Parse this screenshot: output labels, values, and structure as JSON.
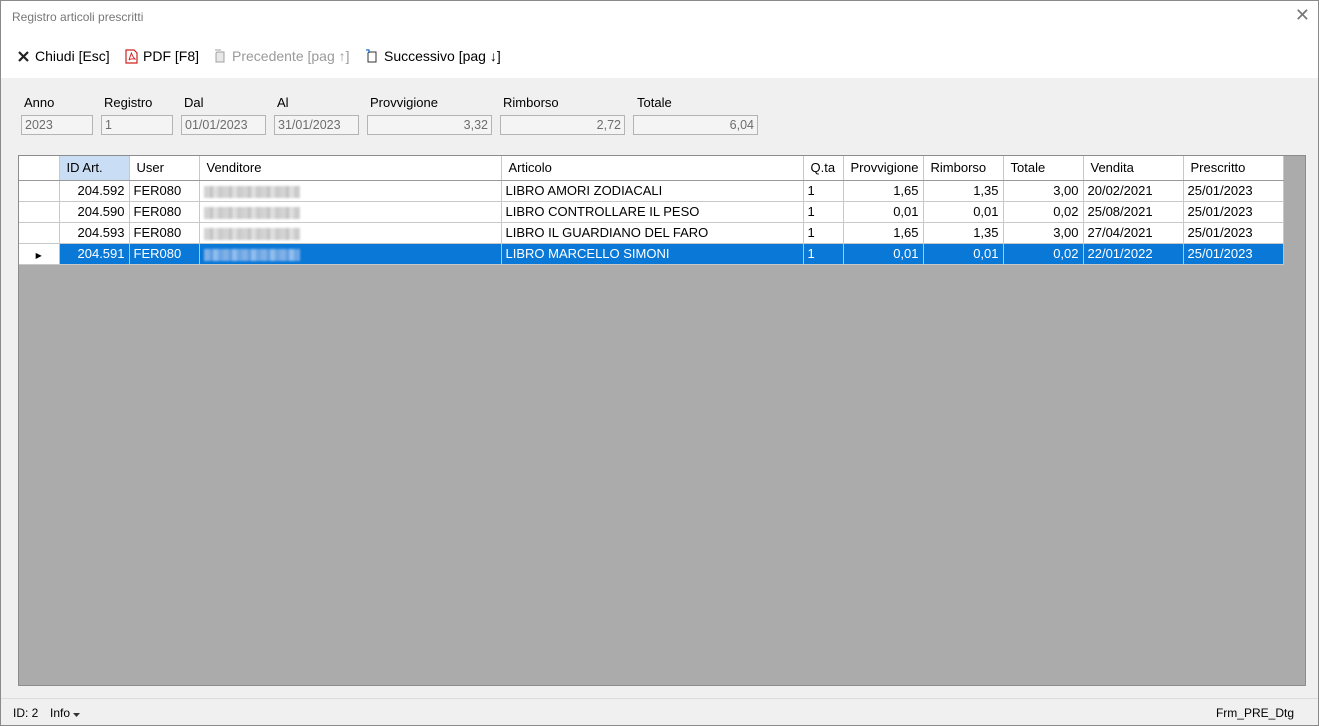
{
  "window": {
    "title": "Registro articoli prescritti",
    "close_glyph": "✕"
  },
  "toolbar": {
    "close_label": "Chiudi [Esc]",
    "pdf_label": "PDF [F8]",
    "prev_label": "Precedente [pag ↑]",
    "next_label": "Successivo [pag ↓]"
  },
  "filters": {
    "anno": {
      "label": "Anno",
      "value": "2023"
    },
    "registro": {
      "label": "Registro",
      "value": "1"
    },
    "dal": {
      "label": "Dal",
      "value": "01/01/2023"
    },
    "al": {
      "label": "Al",
      "value": "31/01/2023"
    },
    "provvigione": {
      "label": "Provvigione",
      "value": "3,32"
    },
    "rimborso": {
      "label": "Rimborso",
      "value": "2,72"
    },
    "totale": {
      "label": "Totale",
      "value": "6,04"
    }
  },
  "grid": {
    "columns": [
      "ID Art.",
      "User",
      "Venditore",
      "Articolo",
      "Q.ta",
      "Provvigione",
      "Rimborso",
      "Totale",
      "Vendita",
      "Prescritto"
    ],
    "sorted_column": "ID Art.",
    "current_row_marker": "▶",
    "rows": [
      {
        "id": "204.592",
        "user": "FER080",
        "articolo": "LIBRO AMORI ZODIACALI",
        "qta": "1",
        "provvigione": "1,65",
        "rimborso": "1,35",
        "totale": "3,00",
        "vendita": "20/02/2021",
        "prescritto": "25/01/2023",
        "selected": false
      },
      {
        "id": "204.590",
        "user": "FER080",
        "articolo": "LIBRO CONTROLLARE IL PESO",
        "qta": "1",
        "provvigione": "0,01",
        "rimborso": "0,01",
        "totale": "0,02",
        "vendita": "25/08/2021",
        "prescritto": "25/01/2023",
        "selected": false
      },
      {
        "id": "204.593",
        "user": "FER080",
        "articolo": "LIBRO IL GUARDIANO DEL FARO",
        "qta": "1",
        "provvigione": "1,65",
        "rimborso": "1,35",
        "totale": "3,00",
        "vendita": "27/04/2021",
        "prescritto": "25/01/2023",
        "selected": false
      },
      {
        "id": "204.591",
        "user": "FER080",
        "articolo": "LIBRO MARCELLO SIMONI",
        "qta": "1",
        "provvigione": "0,01",
        "rimborso": "0,01",
        "totale": "0,02",
        "vendita": "22/01/2022",
        "prescritto": "25/01/2023",
        "selected": true
      }
    ]
  },
  "statusbar": {
    "id_text": "ID: 2",
    "info_label": "Info",
    "form_name": "Frm_PRE_Dtg"
  },
  "colors": {
    "selection": "#0a78d7",
    "sorted_header": "#c9def5",
    "grid_background": "#ababab",
    "pdf_icon": "#d0201f"
  }
}
